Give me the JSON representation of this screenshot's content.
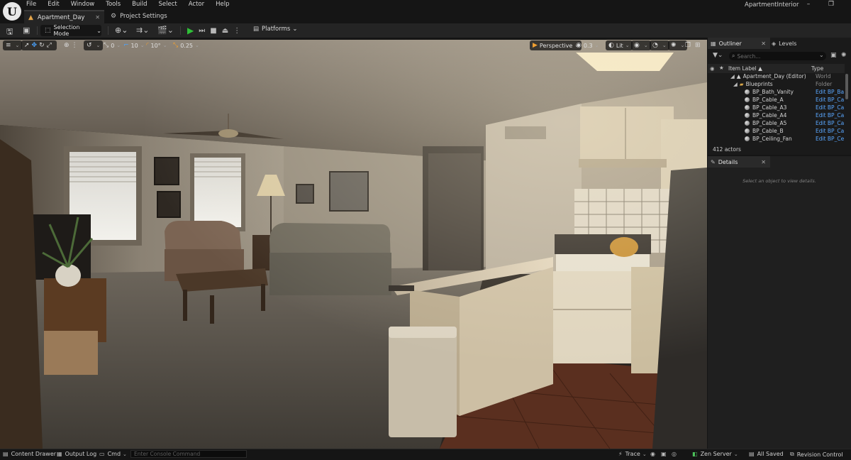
{
  "app": {
    "project_name": "ApartmentInterior",
    "logo": "unreal-logo"
  },
  "menu": [
    "File",
    "Edit",
    "Window",
    "Tools",
    "Build",
    "Select",
    "Actor",
    "Help"
  ],
  "tabs": {
    "level": "Apartment_Day",
    "settings": "Project Settings"
  },
  "toolbar": {
    "selection_mode": "Selection Mode",
    "platforms": "Platforms"
  },
  "viewport_toolbar": {
    "rotation_snap_value": "0",
    "grid_snap_value": "10",
    "angle_snap_value": "10°",
    "scale_snap_value": "0.25",
    "view_mode": "Perspective",
    "camera_speed": "0.3",
    "lighting_mode": "Lit"
  },
  "outliner": {
    "tab_label": "Outliner",
    "levels_tab_label": "Levels",
    "search_placeholder": "Search...",
    "col_item_label": "Item Label ▲",
    "col_type": "Type",
    "rows": [
      {
        "label": "Apartment_Day (Editor)",
        "type": "World",
        "link": false
      },
      {
        "label": "Blueprints",
        "type": "Folder",
        "link": false
      },
      {
        "label": "BP_Bath_Vanity",
        "type": "Edit BP_Bath",
        "link": true
      },
      {
        "label": "BP_Cable_A",
        "type": "Edit BP_Cabl",
        "link": true
      },
      {
        "label": "BP_Cable_A3",
        "type": "Edit BP_Cabl",
        "link": true
      },
      {
        "label": "BP_Cable_A4",
        "type": "Edit BP_Cabl",
        "link": true
      },
      {
        "label": "BP_Cable_A5",
        "type": "Edit BP_Cabl",
        "link": true
      },
      {
        "label": "BP_Cable_B",
        "type": "Edit BP_Cabl",
        "link": true
      },
      {
        "label": "BP_Ceiling_Fan",
        "type": "Edit BP_Ceilin",
        "link": true
      }
    ],
    "actor_count": "412 actors"
  },
  "details": {
    "tab_label": "Details",
    "empty_message": "Select an object to view details."
  },
  "statusbar": {
    "content_drawer": "Content Drawer",
    "output_log": "Output Log",
    "cmd": "Cmd",
    "console_placeholder": "Enter Console Command",
    "trace": "Trace",
    "zen_server": "Zen Server",
    "all_saved": "All Saved",
    "revision_control": "Revision Control"
  },
  "colors": {
    "accent_blue": "#4aa3ff",
    "play_green": "#2fc038",
    "level_icon_orange": "#e6a64a"
  }
}
